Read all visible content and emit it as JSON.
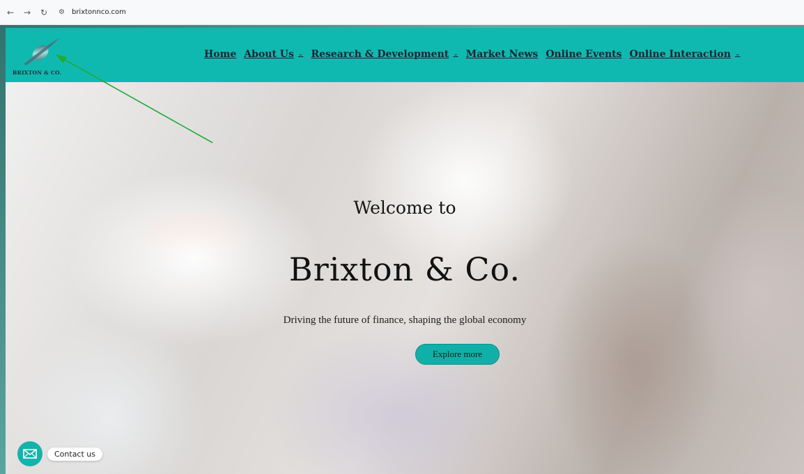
{
  "browser": {
    "back_icon": "arrow-left-icon",
    "forward_icon": "arrow-right-icon",
    "reload_icon": "reload-icon",
    "site_info_icon": "site-info-icon",
    "url": "brixtonnco.com"
  },
  "header": {
    "logo_text": "BRIXTON & CO.",
    "background_color": "#10b9b0",
    "nav": [
      {
        "label": "Home",
        "has_dropdown": false
      },
      {
        "label": "About Us",
        "has_dropdown": true
      },
      {
        "label": "Research & Development",
        "has_dropdown": true
      },
      {
        "label": "Market News",
        "has_dropdown": false
      },
      {
        "label": "Online Events",
        "has_dropdown": false
      },
      {
        "label": "Online Interaction",
        "has_dropdown": true
      }
    ]
  },
  "hero": {
    "welcome": "Welcome to",
    "title": "Brixton & Co.",
    "subtitle": "Driving the future of finance, shaping the global economy",
    "cta_label": "Explore more",
    "cta_color": "#10b0a9"
  },
  "contact_widget": {
    "icon": "mail-icon",
    "label": "Contact us"
  },
  "annotation": {
    "arrow_color": "#1faa3a"
  }
}
